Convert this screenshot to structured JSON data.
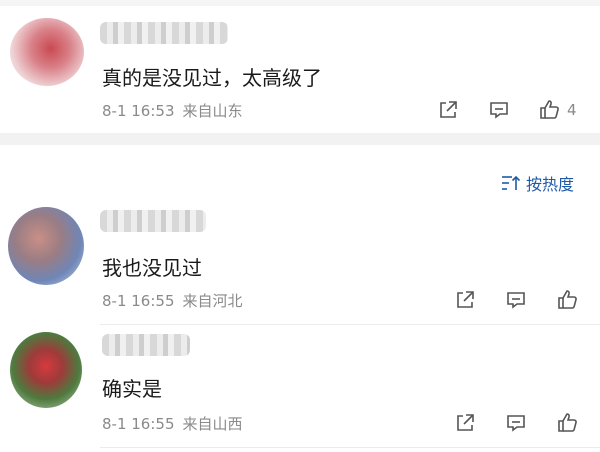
{
  "comments": [
    {
      "text": "真的是没见过，太高级了",
      "date": "8-1 16:53",
      "location": "来自山东",
      "likes": "4"
    },
    {
      "text": "我也没见过",
      "date": "8-1 16:55",
      "location": "来自河北",
      "likes": ""
    },
    {
      "text": "确实是",
      "date": "8-1 16:55",
      "location": "来自山西",
      "likes": ""
    }
  ],
  "sort": {
    "label": "按热度"
  },
  "colors": {
    "accent": "#1f5aa8",
    "meta": "#8a8a8a",
    "text": "#1a1a1a"
  },
  "icons": [
    "share-icon",
    "comment-icon",
    "like-icon",
    "sort-icon"
  ]
}
